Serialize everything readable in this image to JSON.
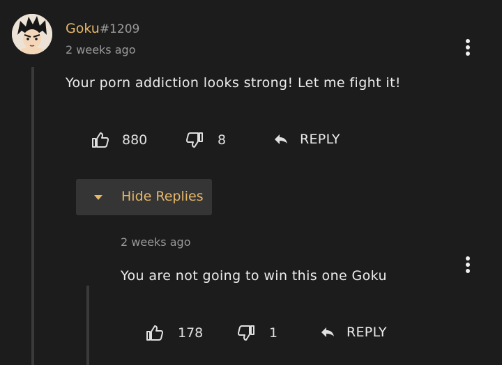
{
  "comment": {
    "username": "Goku",
    "user_tag": "#1209",
    "timestamp": "2 weeks ago",
    "text": "Your porn addiction looks strong! Let me fight it!",
    "likes": "880",
    "dislikes": "8",
    "reply_label": "REPLY"
  },
  "replies_toggle": {
    "label": "Hide Replies"
  },
  "reply": {
    "timestamp": "2 weeks ago",
    "text": "You are not going to win this one Goku",
    "likes": "178",
    "dislikes": "1",
    "reply_label": "REPLY"
  },
  "colors": {
    "background": "#1c1c1c",
    "accent": "#e6b86a",
    "muted": "#9a9a9a",
    "thread_line": "#3a3a3a"
  },
  "icons": [
    "avatar",
    "thumbs-up-icon",
    "thumbs-down-icon",
    "reply-arrow-icon",
    "kebab-menu-icon",
    "caret-down-icon"
  ]
}
